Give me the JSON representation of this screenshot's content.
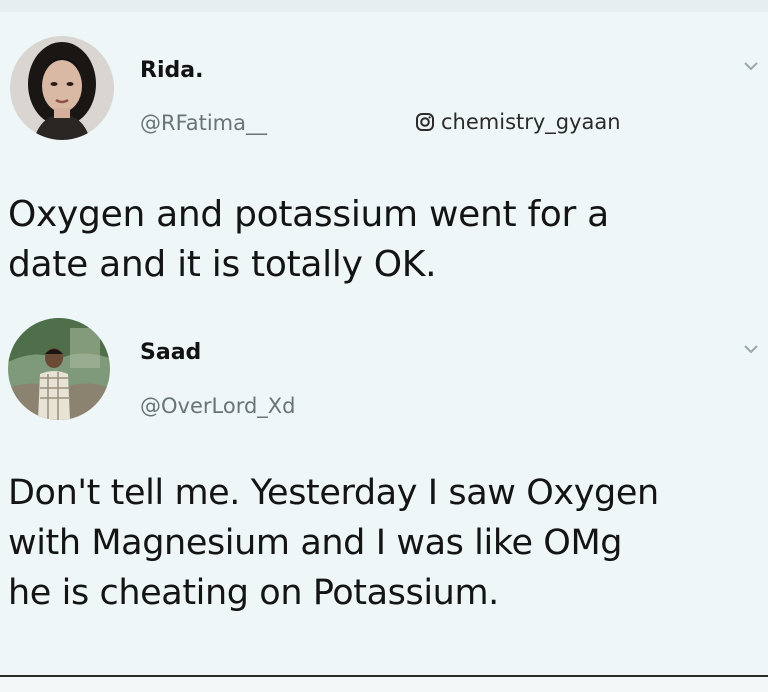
{
  "tweets": [
    {
      "display_name": "Rida.",
      "handle": "@RFatima__",
      "text_lines": [
        "Oxygen and potassium went for a",
        "date and it is totally OK."
      ],
      "avatar_icon": "woman-portrait-avatar",
      "menu_icon": "chevron-down-icon"
    },
    {
      "display_name": "Saad",
      "handle": "@OverLord_Xd",
      "text_lines": [
        "Don't tell me. Yesterday I saw Oxygen",
        "with Magnesium and I was like OMg",
        "he is cheating on Potassium."
      ],
      "avatar_icon": "man-outdoor-avatar",
      "menu_icon": "chevron-down-icon"
    }
  ],
  "watermark": {
    "text": "chemistry_gyaan",
    "icon": "instagram-icon"
  },
  "colors": {
    "background": "#eef6f8",
    "handle": "#687478",
    "text": "#141414"
  }
}
